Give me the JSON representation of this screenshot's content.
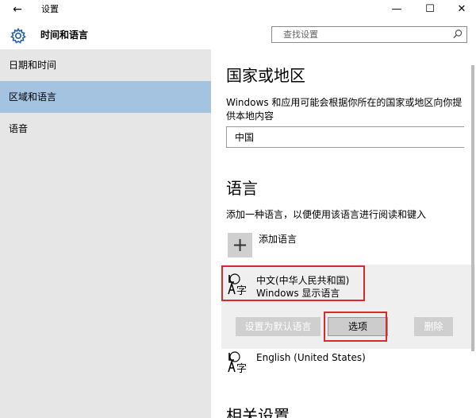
{
  "window": {
    "title": "设置",
    "back_glyph": "←",
    "minimize_glyph": "—",
    "maximize_glyph": "☐",
    "close_glyph": "✕"
  },
  "header": {
    "title": "时间和语言",
    "gear_icon": "gear-icon"
  },
  "search": {
    "placeholder": "查找设置",
    "icon": "search-icon"
  },
  "sidebar": {
    "items": [
      {
        "label": "日期和时间",
        "active": false
      },
      {
        "label": "区域和语言",
        "active": true
      },
      {
        "label": "语音",
        "active": false
      }
    ]
  },
  "region": {
    "heading": "国家或地区",
    "description": "Windows 和应用可能会根据你所在的国家或地区向你提供本地内容",
    "value": "中国"
  },
  "language": {
    "heading": "语言",
    "description": "添加一种语言，以便使用该语言进行阅读和键入",
    "add_glyph": "+",
    "add_label": "添加语言",
    "items": [
      {
        "name": "中文(中华人民共和国)",
        "sub": "Windows 显示语言",
        "selected": true
      },
      {
        "name": "English (United States)",
        "sub": "",
        "selected": false
      }
    ],
    "buttons": {
      "set_default": "设置为默认语言",
      "options": "选项",
      "remove": "删除"
    }
  },
  "related": {
    "heading": "相关设置"
  },
  "colors": {
    "sidebar_bg": "#e6e6e6",
    "sidebar_active": "#a3c3e0",
    "highlight_border": "#d62b2b"
  }
}
